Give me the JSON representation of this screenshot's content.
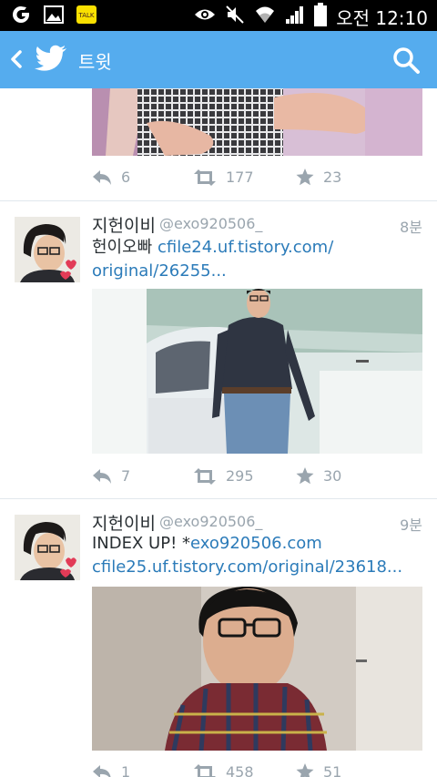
{
  "statusbar": {
    "time": "오전 12:10",
    "icons": [
      "g-icon",
      "gallery-icon",
      "kakaotalk-icon",
      "eye-icon",
      "mute-icon",
      "wifi-icon",
      "signal-icon",
      "battery-icon"
    ],
    "kakao_label": "TALK"
  },
  "appbar": {
    "title": "트윗",
    "color": "#55acee"
  },
  "tweets": [
    {
      "retweets": "",
      "replies": "6",
      "retweet_count": "177",
      "favorites": "23"
    },
    {
      "name": "지헌이비",
      "handle": "@exo920506_",
      "time": "8분",
      "text_plain": "헌이오빠 ",
      "link1": "cfile24.uf.tistory.com/",
      "link2": "original/26255...",
      "replies": "7",
      "retweet_count": "295",
      "favorites": "30"
    },
    {
      "name": "지헌이비",
      "handle": "@exo920506_",
      "time": "9분",
      "text_plain": "INDEX UP! *",
      "link1": "exo920506.com",
      "link2": "cfile25.uf.tistory.com/original/23618...",
      "replies": "1",
      "retweet_count": "458",
      "favorites": "51"
    }
  ],
  "colors": {
    "link": "#2b7bb9",
    "meta": "#9aa5ae",
    "divider": "#e1e8ed"
  }
}
